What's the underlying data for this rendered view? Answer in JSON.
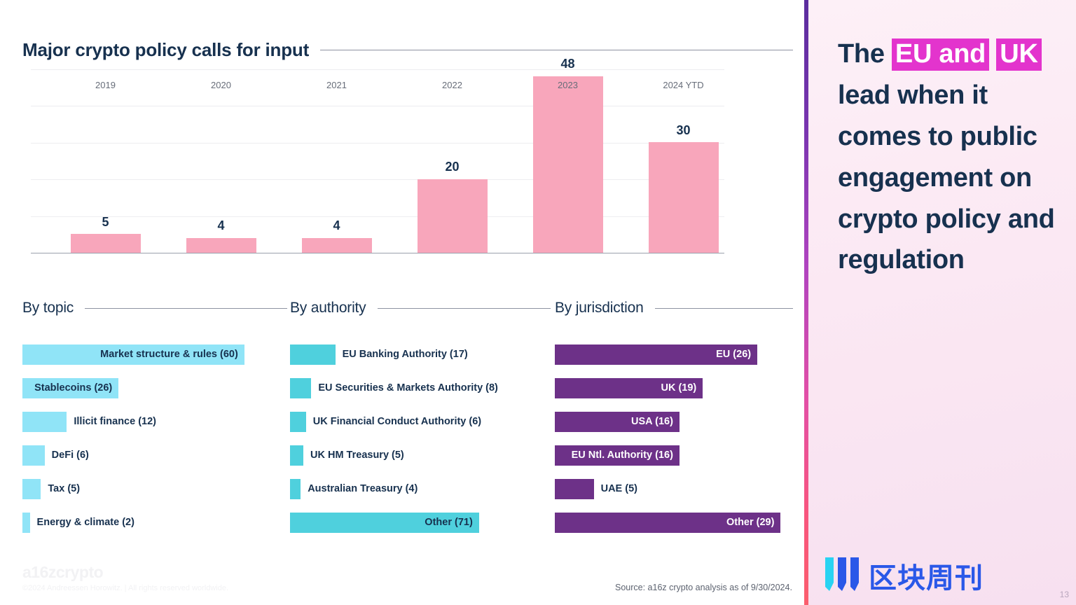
{
  "slide": {
    "main_title": "Major crypto policy calls for input",
    "source_note": "Source: a16z crypto analysis as of 9/30/2024.",
    "page_number": "13",
    "brand_logo": "a16zcrypto",
    "copyright": "©2024 Andreessen Horowitz.  |  All rights reserved worldwide."
  },
  "right_panel": {
    "headline_parts": [
      {
        "text": "The ",
        "highlight": false
      },
      {
        "text": "EU and",
        "highlight": true
      },
      {
        "text": " ",
        "highlight": false
      },
      {
        "text": "UK",
        "highlight": true
      },
      {
        "text": " lead when it comes to public engagement on crypto policy and regulation",
        "highlight": false
      }
    ],
    "headline_plain": "The EU and UK lead when it comes to public engagement on crypto policy and regulation",
    "watermark_text": "区块周刊",
    "colors": {
      "highlight": "#e334cd",
      "headline_text": "#17314f",
      "panel_bg_top": "#fdf0f7",
      "panel_bg_bottom": "#f7e0f0"
    }
  },
  "chart_data": [
    {
      "id": "col-chart",
      "type": "bar",
      "title": "Major crypto policy calls for input",
      "xlabel": "",
      "ylabel": "",
      "orientation": "vertical",
      "categories": [
        "2019",
        "2020",
        "2021",
        "2022",
        "2023",
        "2024 YTD"
      ],
      "values": [
        5,
        4,
        4,
        20,
        48,
        30
      ],
      "ylim": [
        0,
        50
      ],
      "gridlines": [
        10,
        20,
        30,
        40,
        50
      ],
      "grid": true,
      "legend": "none",
      "bar_color": "#f8a6bb",
      "data_labels": [
        "5",
        "4",
        "4",
        "20",
        "48",
        "30"
      ]
    },
    {
      "id": "by-topic",
      "type": "bar",
      "title": "By topic",
      "orientation": "horizontal",
      "xlabel": "",
      "ylabel": "",
      "legend": "none",
      "bar_color": "#90e4f7",
      "max_value": 60,
      "categories": [
        "Market structure & rules",
        "Stablecoins",
        "Illicit finance",
        "DeFi",
        "Tax",
        "Energy & climate"
      ],
      "values": [
        60,
        26,
        12,
        6,
        5,
        2
      ],
      "labels": [
        "Market structure & rules (60)",
        "Stablecoins (26)",
        "Illicit finance (12)",
        "DeFi (6)",
        "Tax (5)",
        "Energy & climate (2)"
      ],
      "label_inside": [
        true,
        true,
        false,
        false,
        false,
        false
      ]
    },
    {
      "id": "by-authority",
      "type": "bar",
      "title": "By authority",
      "orientation": "horizontal",
      "xlabel": "",
      "ylabel": "",
      "legend": "none",
      "bar_color": "#4fd0dd",
      "max_value": 71,
      "categories": [
        "EU Banking Authority",
        "EU Securities & Markets Authority",
        "UK Financial Conduct Authority",
        "UK HM Treasury",
        "Australian Treasury",
        "Other"
      ],
      "values": [
        17,
        8,
        6,
        5,
        4,
        71
      ],
      "labels": [
        "EU Banking Authority (17)",
        "EU Securities & Markets Authority (8)",
        "UK Financial Conduct Authority (6)",
        "UK HM Treasury (5)",
        "Australian Treasury (4)",
        "Other (71)"
      ],
      "label_inside": [
        false,
        false,
        false,
        false,
        false,
        true
      ]
    },
    {
      "id": "by-jurisdiction",
      "type": "bar",
      "title": "By jurisdiction",
      "orientation": "horizontal",
      "xlabel": "",
      "ylabel": "",
      "legend": "none",
      "bar_color": "#6d3188",
      "max_value": 29,
      "categories": [
        "EU",
        "UK",
        "USA",
        "EU Ntl. Authority",
        "UAE",
        "Other"
      ],
      "values": [
        26,
        19,
        16,
        16,
        5,
        29
      ],
      "labels": [
        "EU (26)",
        "UK (19)",
        "USA (16)",
        "EU Ntl. Authority (16)",
        "UAE (5)",
        "Other (29)"
      ],
      "label_inside": [
        true,
        true,
        true,
        true,
        false,
        true
      ]
    }
  ]
}
